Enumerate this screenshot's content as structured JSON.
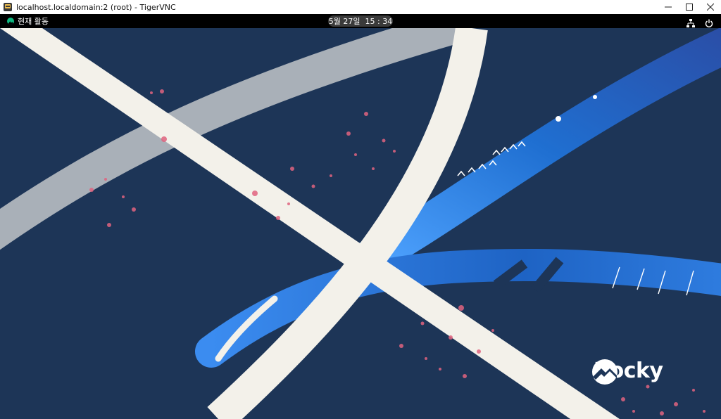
{
  "window": {
    "title": "localhost.localdomain:2 (root) - TigerVNC",
    "minimize_icon": "minimize-icon",
    "maximize_icon": "maximize-icon",
    "close_icon": "close-icon"
  },
  "topbar": {
    "activities_label": "현재 활동",
    "clock": "5월 27일  15 : 34",
    "network_icon": "network-icon",
    "power_icon": "power-icon"
  },
  "desktop": {
    "logo_text": "Rocky",
    "colors": {
      "background": "#1d3557",
      "ribbon": "#f3f1ea",
      "grey_ribbon": "#a9b0b8",
      "blue_ribbon": "#1f6fd1",
      "splatter": "#e0637f"
    }
  }
}
